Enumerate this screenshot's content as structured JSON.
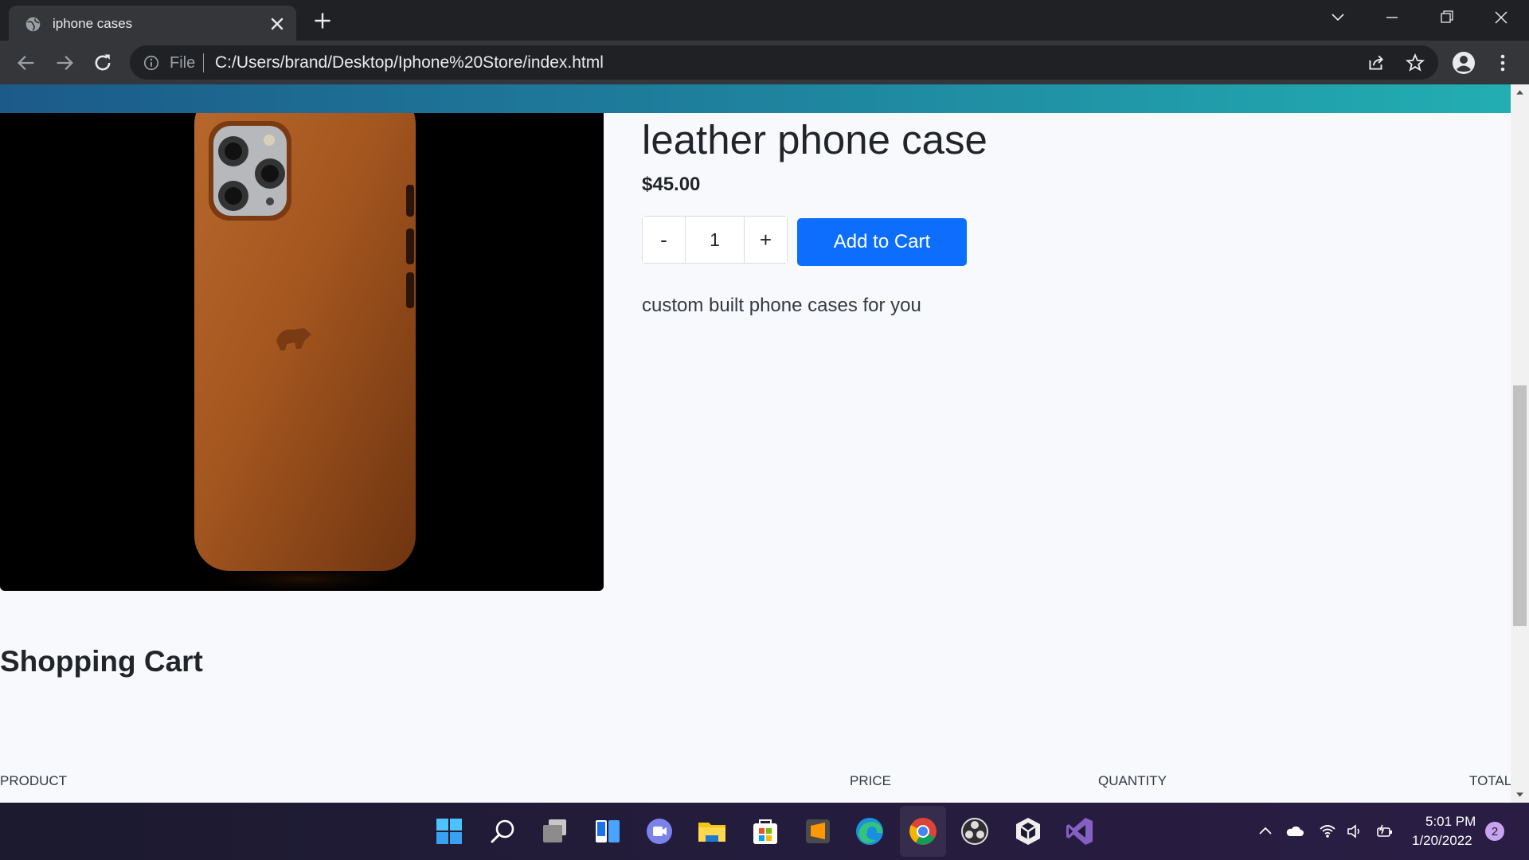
{
  "browser": {
    "tab_title": "iphone cases",
    "address_scheme": "File",
    "address_url": "C:/Users/brand/Desktop/Iphone%20Store/index.html",
    "icons": [
      "globe-icon",
      "close-icon",
      "plus-icon",
      "chevron-down-icon",
      "minimize-icon",
      "restore-icon",
      "window-close-icon",
      "back-icon",
      "forward-icon",
      "reload-icon",
      "info-icon",
      "share-icon",
      "star-icon",
      "profile-icon",
      "kebab-menu-icon"
    ]
  },
  "product": {
    "title": "leather phone case",
    "price": "$45.00",
    "qty_minus": "-",
    "qty_value": "1",
    "qty_plus": "+",
    "add_to_cart": "Add to Cart",
    "description": "custom built phone cases for you",
    "image_desc_icon": "leather-phone-case-image"
  },
  "cart": {
    "heading": "Shopping Cart",
    "columns": [
      "PRODUCT",
      "PRICE",
      "QUANTITY",
      "TOTAL"
    ]
  },
  "taskbar": {
    "apps": [
      "windows-start-icon",
      "search-icon",
      "task-view-icon",
      "widgets-icon",
      "teams-chat-icon",
      "file-explorer-icon",
      "microsoft-store-icon",
      "sublime-text-icon",
      "edge-icon",
      "chrome-icon",
      "obs-icon",
      "unity-icon",
      "visual-studio-icon"
    ],
    "time": "5:01 PM",
    "date": "1/20/2022",
    "notifications": "2"
  },
  "colors": {
    "accent_button": "#0d6efd",
    "page_bg": "#f8f9fc",
    "browser_frame": "#202124"
  }
}
